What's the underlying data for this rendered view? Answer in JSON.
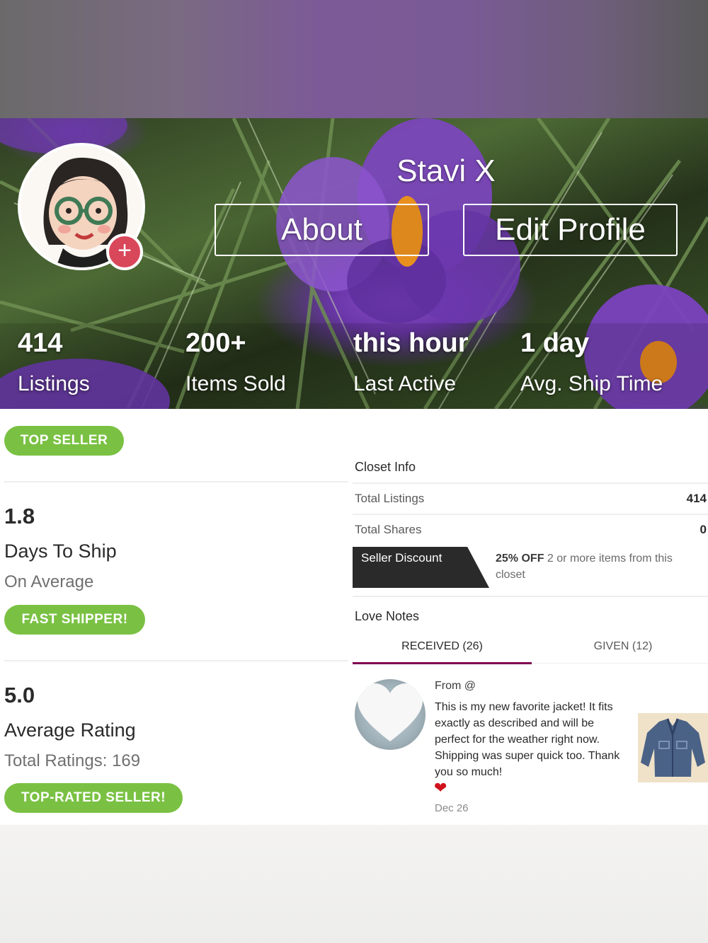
{
  "colors": {
    "badge_green": "#7ac143",
    "plus_red": "#d9475a",
    "tab_accent": "#7f0353",
    "heart_red": "#d0111b"
  },
  "profile": {
    "name": "Stavi X",
    "avatar_plus_icon": "+",
    "about_label": "About",
    "edit_label": "Edit Profile"
  },
  "stats": [
    {
      "value": "414",
      "label": "Listings"
    },
    {
      "value": "200+",
      "label": "Items Sold"
    },
    {
      "value": "this hour",
      "label": "Last Active"
    },
    {
      "value": "1 day",
      "label": "Avg. Ship Time"
    }
  ],
  "left": {
    "top_seller_badge": "TOP SELLER",
    "ship": {
      "value": "1.8",
      "title": "Days To Ship",
      "sub": "On Average",
      "badge": "FAST SHIPPER!"
    },
    "rating": {
      "value": "5.0",
      "title": "Average Rating",
      "sub": "Total Ratings: 169",
      "badge": "TOP-RATED SELLER!"
    }
  },
  "closet_info": {
    "title": "Closet Info",
    "rows": [
      {
        "label": "Total Listings",
        "value": "414"
      },
      {
        "label": "Total Shares",
        "value": "0"
      }
    ],
    "discount_label": "Seller Discount",
    "discount_bold": "25% OFF",
    "discount_text": "2 or more items from this closet"
  },
  "love_notes": {
    "title": "Love Notes",
    "tabs": [
      {
        "label": "RECEIVED (26)",
        "active": true
      },
      {
        "label": "GIVEN (12)",
        "active": false
      }
    ],
    "note": {
      "from": "From @",
      "body": "This is my new favorite jacket! It fits exactly as described and will be perfect for the weather right now. Shipping was super quick too. Thank you so much!",
      "heart": "❤",
      "date": "Dec 26",
      "avatar_icon": "white-heart-icon",
      "thumb_icon": "denim-jacket-icon"
    }
  }
}
